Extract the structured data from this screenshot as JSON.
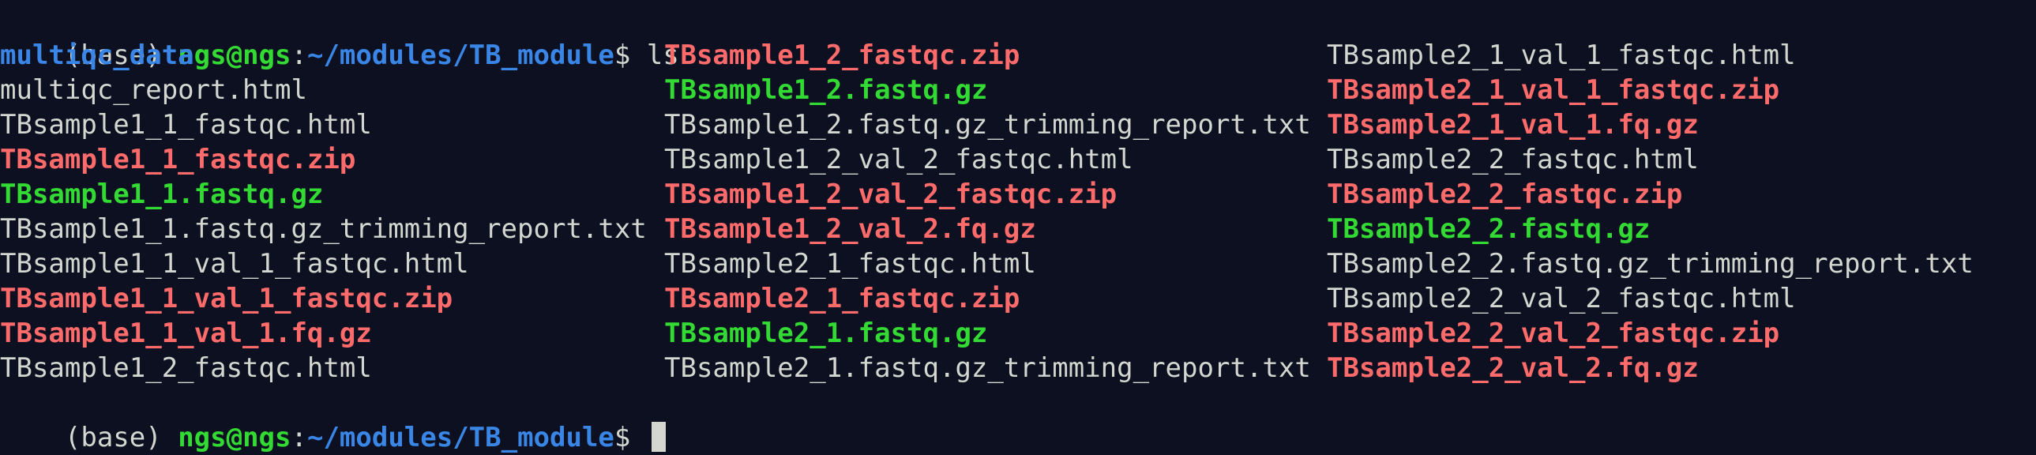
{
  "prompt": {
    "env": "(base) ",
    "user_host": "ngs@ngs",
    "colon": ":",
    "path": "~/modules/TB_module",
    "symbol": "$ ",
    "command": "ls"
  },
  "listing": {
    "columns": [
      [
        {
          "name": "multiqc_data",
          "type": "dir"
        },
        {
          "name": "multiqc_report.html",
          "type": "file"
        },
        {
          "name": "TBsample1_1_fastqc.html",
          "type": "file"
        },
        {
          "name": "TBsample1_1_fastqc.zip",
          "type": "archive"
        },
        {
          "name": "TBsample1_1.fastq.gz",
          "type": "fastq"
        },
        {
          "name": "TBsample1_1.fastq.gz_trimming_report.txt",
          "type": "file"
        },
        {
          "name": "TBsample1_1_val_1_fastqc.html",
          "type": "file"
        },
        {
          "name": "TBsample1_1_val_1_fastqc.zip",
          "type": "archive"
        },
        {
          "name": "TBsample1_1_val_1.fq.gz",
          "type": "archive"
        },
        {
          "name": "TBsample1_2_fastqc.html",
          "type": "file"
        }
      ],
      [
        {
          "name": "TBsample1_2_fastqc.zip",
          "type": "archive"
        },
        {
          "name": "TBsample1_2.fastq.gz",
          "type": "fastq"
        },
        {
          "name": "TBsample1_2.fastq.gz_trimming_report.txt",
          "type": "file"
        },
        {
          "name": "TBsample1_2_val_2_fastqc.html",
          "type": "file"
        },
        {
          "name": "TBsample1_2_val_2_fastqc.zip",
          "type": "archive"
        },
        {
          "name": "TBsample1_2_val_2.fq.gz",
          "type": "archive"
        },
        {
          "name": "TBsample2_1_fastqc.html",
          "type": "file"
        },
        {
          "name": "TBsample2_1_fastqc.zip",
          "type": "archive"
        },
        {
          "name": "TBsample2_1.fastq.gz",
          "type": "fastq"
        },
        {
          "name": "TBsample2_1.fastq.gz_trimming_report.txt",
          "type": "file"
        }
      ],
      [
        {
          "name": "TBsample2_1_val_1_fastqc.html",
          "type": "file"
        },
        {
          "name": "TBsample2_1_val_1_fastqc.zip",
          "type": "archive"
        },
        {
          "name": "TBsample2_1_val_1.fq.gz",
          "type": "archive"
        },
        {
          "name": "TBsample2_2_fastqc.html",
          "type": "file"
        },
        {
          "name": "TBsample2_2_fastqc.zip",
          "type": "archive"
        },
        {
          "name": "TBsample2_2.fastq.gz",
          "type": "fastq"
        },
        {
          "name": "TBsample2_2.fastq.gz_trimming_report.txt",
          "type": "file"
        },
        {
          "name": "TBsample2_2_val_2_fastqc.html",
          "type": "file"
        },
        {
          "name": "TBsample2_2_val_2_fastqc.zip",
          "type": "archive"
        },
        {
          "name": "TBsample2_2_val_2.fq.gz",
          "type": "archive"
        }
      ]
    ]
  },
  "colors": {
    "background": "#0c1021",
    "text": "#d3d7cf",
    "dir": "#3a86e6",
    "archive": "#ff6b6b",
    "fastq": "#33da33",
    "user_host": "#33da33",
    "path": "#3a86e6"
  }
}
